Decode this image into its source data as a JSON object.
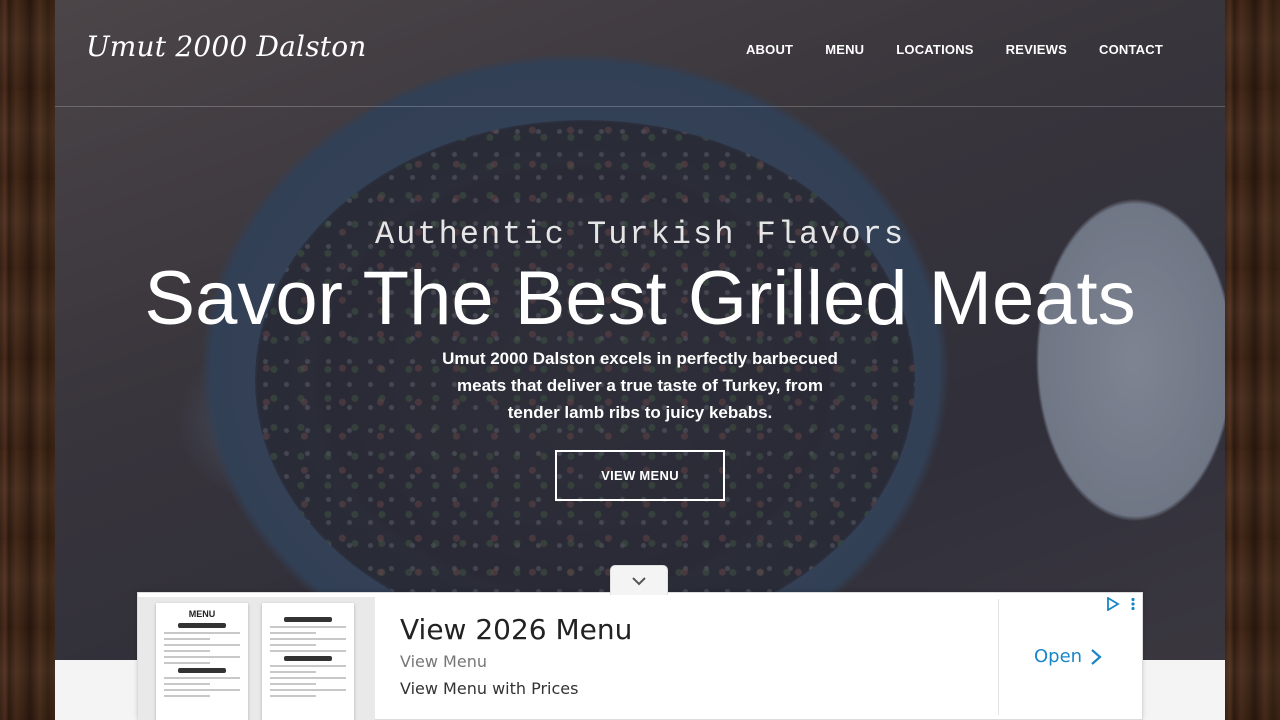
{
  "brand": {
    "logo": "Umut 2000 Dalston"
  },
  "nav": {
    "items": [
      "ABOUT",
      "MENU",
      "LOCATIONS",
      "REVIEWS",
      "CONTACT"
    ]
  },
  "hero": {
    "tagline": "Authentic Turkish Flavors",
    "title": "Savor The Best Grilled Meats",
    "description": "Umut 2000 Dalston excels in perfectly barbecued meats that deliver a true taste of Turkey, from tender lamb ribs to juicy kebabs.",
    "button_label": "VIEW MENU"
  },
  "ad": {
    "thumbnail_title": "MENU",
    "title": "View 2026 Menu",
    "subtitle": "View Menu",
    "description": "View Menu with Prices",
    "cta_label": "Open",
    "icons": [
      "adchoices-icon",
      "more-vert-icon",
      "chevron-right-icon"
    ],
    "accent_color": "#1a86c8"
  },
  "ui": {
    "collapse_icon": "chevron-down-icon"
  }
}
